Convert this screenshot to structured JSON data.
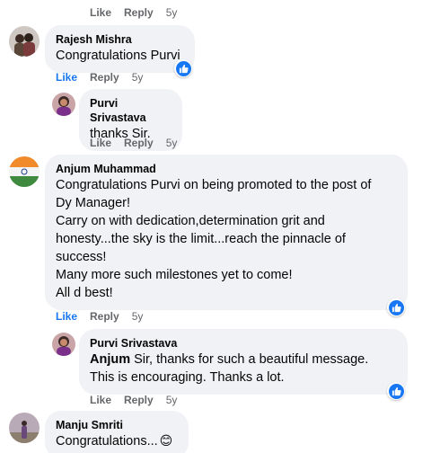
{
  "colors": {
    "bubble": "#f0f2f5",
    "like_blue": "#1877f2",
    "meta_gray": "#65676b"
  },
  "top_actions": {
    "like": "Like",
    "reply": "Reply",
    "time": "5y"
  },
  "comments": [
    {
      "author": "Rajesh Mishra",
      "lines": [
        "Congratulations Purvi"
      ],
      "actions": {
        "like": "Like",
        "reply": "Reply",
        "time": "5y"
      },
      "reaction_icon": "thumbs-up-icon"
    },
    {
      "author": "Purvi Srivastava",
      "lines": [
        "thanks Sir."
      ],
      "actions": {
        "like": "Like",
        "reply": "Reply",
        "time": "5y"
      }
    },
    {
      "author": "Anjum Muhammad",
      "lines": [
        "Congratulations Purvi on being promoted to the post of",
        "Dy Manager!",
        "Carry on with dedication,determination grit and",
        "honesty...the sky is the limit...reach the pinnacle of",
        "success!",
        "Many more such milestones yet to come!",
        "All d best!"
      ],
      "actions": {
        "like": "Like",
        "reply": "Reply",
        "time": "5y"
      },
      "reaction_icon": "thumbs-up-icon"
    },
    {
      "author": "Purvi Srivastava",
      "mention": "Anjum",
      "line1_rest": " Sir, thanks for such a beautiful message.",
      "line2": "This is encouraging. Thanks a lot.",
      "actions": {
        "like": "Like",
        "reply": "Reply",
        "time": "5y"
      },
      "reaction_icon": "thumbs-up-icon"
    },
    {
      "author": "Manju Smriti",
      "text": "Congratulations...",
      "emoji": "😊"
    }
  ]
}
